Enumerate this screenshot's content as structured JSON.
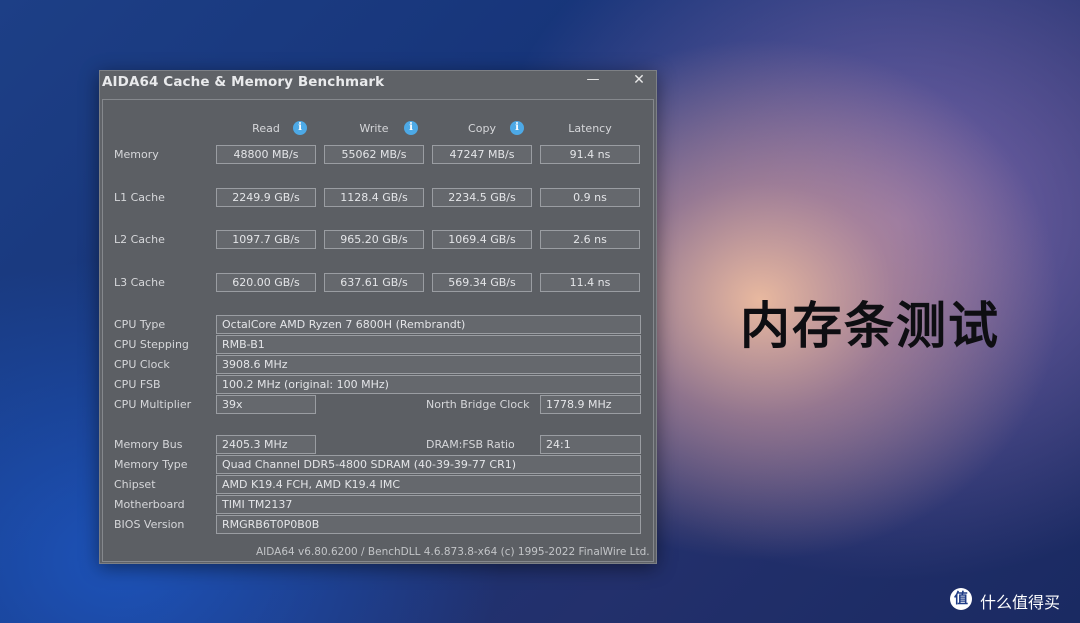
{
  "window": {
    "title": "AIDA64 Cache & Memory Benchmark",
    "minimize_icon": "minimize-icon",
    "close_icon": "close-icon"
  },
  "columns": [
    "Read",
    "Write",
    "Copy",
    "Latency"
  ],
  "bench_rows": [
    {
      "label": "Memory",
      "values": [
        "48800 MB/s",
        "55062 MB/s",
        "47247 MB/s",
        "91.4 ns"
      ]
    },
    {
      "label": "L1 Cache",
      "values": [
        "2249.9 GB/s",
        "1128.4 GB/s",
        "2234.5 GB/s",
        "0.9 ns"
      ]
    },
    {
      "label": "L2 Cache",
      "values": [
        "1097.7 GB/s",
        "965.20 GB/s",
        "1069.4 GB/s",
        "2.6 ns"
      ]
    },
    {
      "label": "L3 Cache",
      "values": [
        "620.00 GB/s",
        "637.61 GB/s",
        "569.34 GB/s",
        "11.4 ns"
      ]
    }
  ],
  "cpu": {
    "type_label": "CPU Type",
    "type_value": "OctalCore AMD Ryzen 7 6800H  (Rembrandt)",
    "stepping_label": "CPU Stepping",
    "stepping_value": "RMB-B1",
    "clock_label": "CPU Clock",
    "clock_value": "3908.6 MHz",
    "fsb_label": "CPU FSB",
    "fsb_value": "100.2 MHz  (original: 100 MHz)",
    "multiplier_label": "CPU Multiplier",
    "multiplier_value": "39x",
    "nb_clock_label": "North Bridge Clock",
    "nb_clock_value": "1778.9 MHz"
  },
  "system": {
    "bus_label": "Memory Bus",
    "bus_value": "2405.3 MHz",
    "ratio_label": "DRAM:FSB Ratio",
    "ratio_value": "24:1",
    "mem_type_label": "Memory Type",
    "mem_type_value": "Quad Channel DDR5-4800 SDRAM  (40-39-39-77 CR1)",
    "chipset_label": "Chipset",
    "chipset_value": "AMD K19.4 FCH, AMD K19.4 IMC",
    "motherboard_label": "Motherboard",
    "motherboard_value": "TIMI TM2137",
    "bios_label": "BIOS Version",
    "bios_value": "RMGRB6T0P0B0B"
  },
  "footer": "AIDA64 v6.80.6200 / BenchDLL 4.6.873.8-x64  (c) 1995-2022 FinalWire Ltd.",
  "headline": "内存条测试",
  "brand": {
    "logo": "值",
    "text": "什么值得买"
  },
  "icons": {
    "info": "info-icon"
  }
}
